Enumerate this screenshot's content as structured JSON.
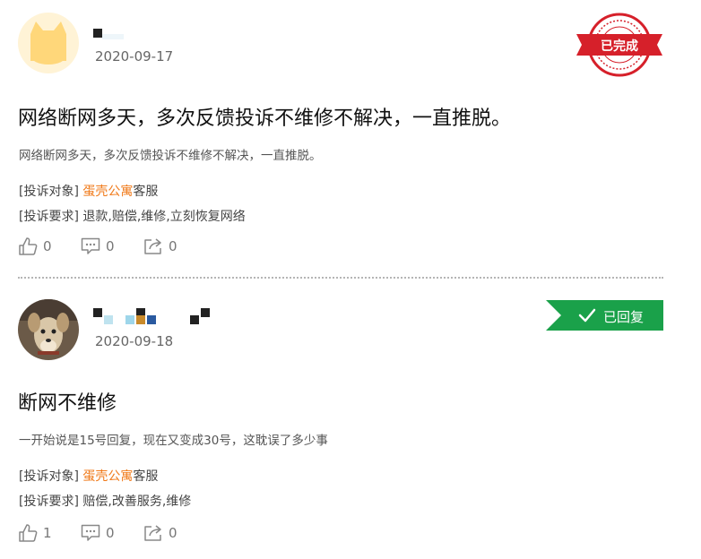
{
  "complaints": [
    {
      "date": "2020-09-17",
      "status": "已完成",
      "title": "网络断网多天，多次反馈投诉不维修不解决，一直推脱。",
      "description": "网络断网多天，多次反馈投诉不维修不解决，一直推脱。",
      "target_label": "[投诉对象]",
      "target_company": "蛋壳公寓",
      "target_suffix": "客服",
      "demand_label": "[投诉要求]",
      "demand_value": "退款,赔偿,维修,立刻恢复网络",
      "likes": "0",
      "comments": "0",
      "shares": "0"
    },
    {
      "date": "2020-09-18",
      "status": "已回复",
      "title": "断网不维修",
      "description": "一开始说是15号回复，现在又变成30号，这耽误了多少事",
      "target_label": "[投诉对象]",
      "target_company": "蛋壳公寓",
      "target_suffix": "客服",
      "demand_label": "[投诉要求]",
      "demand_value": "赔偿,改善服务,维修",
      "likes": "1",
      "comments": "0",
      "shares": "0"
    }
  ],
  "icons": {
    "like": "thumbs-up-icon",
    "comment": "comment-icon",
    "share": "share-icon",
    "check": "check-icon"
  },
  "colors": {
    "company": "#f07a1a",
    "stamp_red": "#d6202a",
    "replied_green": "#1aa14a"
  }
}
